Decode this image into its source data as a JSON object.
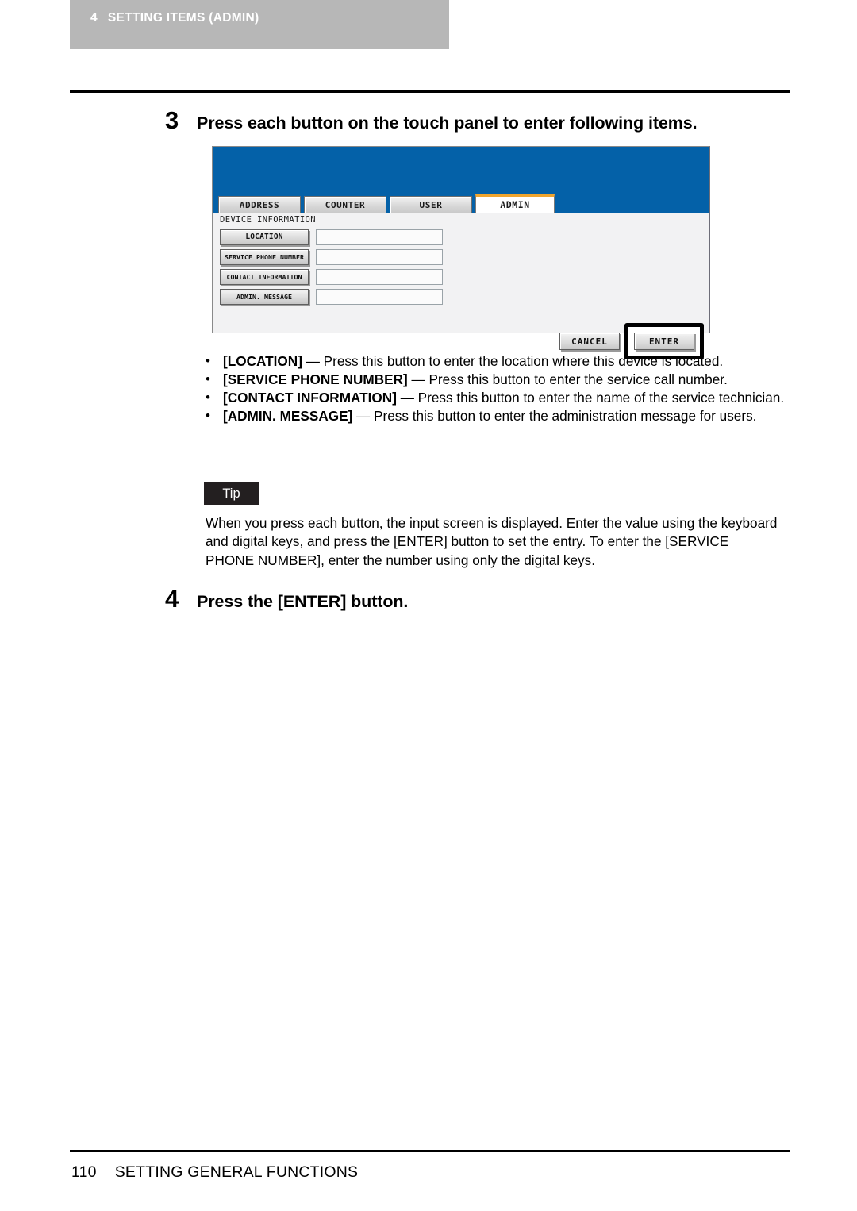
{
  "running_head": {
    "chapter_number": "4",
    "chapter_title": "SETTING ITEMS (ADMIN)",
    "band_color": "#b7b7b7"
  },
  "steps": {
    "step3": {
      "number": "3",
      "text": "Press each button on the touch panel to enter following items."
    },
    "step4": {
      "number": "4",
      "text": "Press the [ENTER] button."
    }
  },
  "touch_panel": {
    "header_color": "#0461a8",
    "active_tab_accent": "#f0a52e",
    "tabs": [
      {
        "label": "ADDRESS",
        "active": false
      },
      {
        "label": "COUNTER",
        "active": false
      },
      {
        "label": "USER",
        "active": false
      },
      {
        "label": "ADMIN",
        "active": true
      }
    ],
    "section_label": "DEVICE INFORMATION",
    "fields": [
      {
        "button": "LOCATION",
        "value": ""
      },
      {
        "button": "SERVICE PHONE NUMBER",
        "value": ""
      },
      {
        "button": "CONTACT INFORMATION",
        "value": ""
      },
      {
        "button": "ADMIN. MESSAGE",
        "value": ""
      }
    ],
    "actions": {
      "cancel": "CANCEL",
      "enter": "ENTER",
      "highlighted": "ENTER"
    }
  },
  "bullets": [
    {
      "dot": "•",
      "term": "[LOCATION]",
      "description": " — Press this button to enter the location where this device is located."
    },
    {
      "dot": "•",
      "term": "[SERVICE PHONE NUMBER]",
      "description": " — Press this button to enter the service call number."
    },
    {
      "dot": "•",
      "term": "[CONTACT INFORMATION]",
      "description": " — Press this button to enter the name of the service technician."
    },
    {
      "dot": "•",
      "term": "[ADMIN. MESSAGE]",
      "description": " — Press this button to enter the administration message for users."
    }
  ],
  "tip": {
    "label": "Tip",
    "text": "When you press each button, the input screen is displayed.  Enter the value using the keyboard and digital keys, and press the [ENTER] button to set the entry.  To enter the [SERVICE PHONE NUMBER], enter the number using only the digital keys."
  },
  "footer": {
    "page_number": "110",
    "section_title": "SETTING GENERAL FUNCTIONS"
  }
}
